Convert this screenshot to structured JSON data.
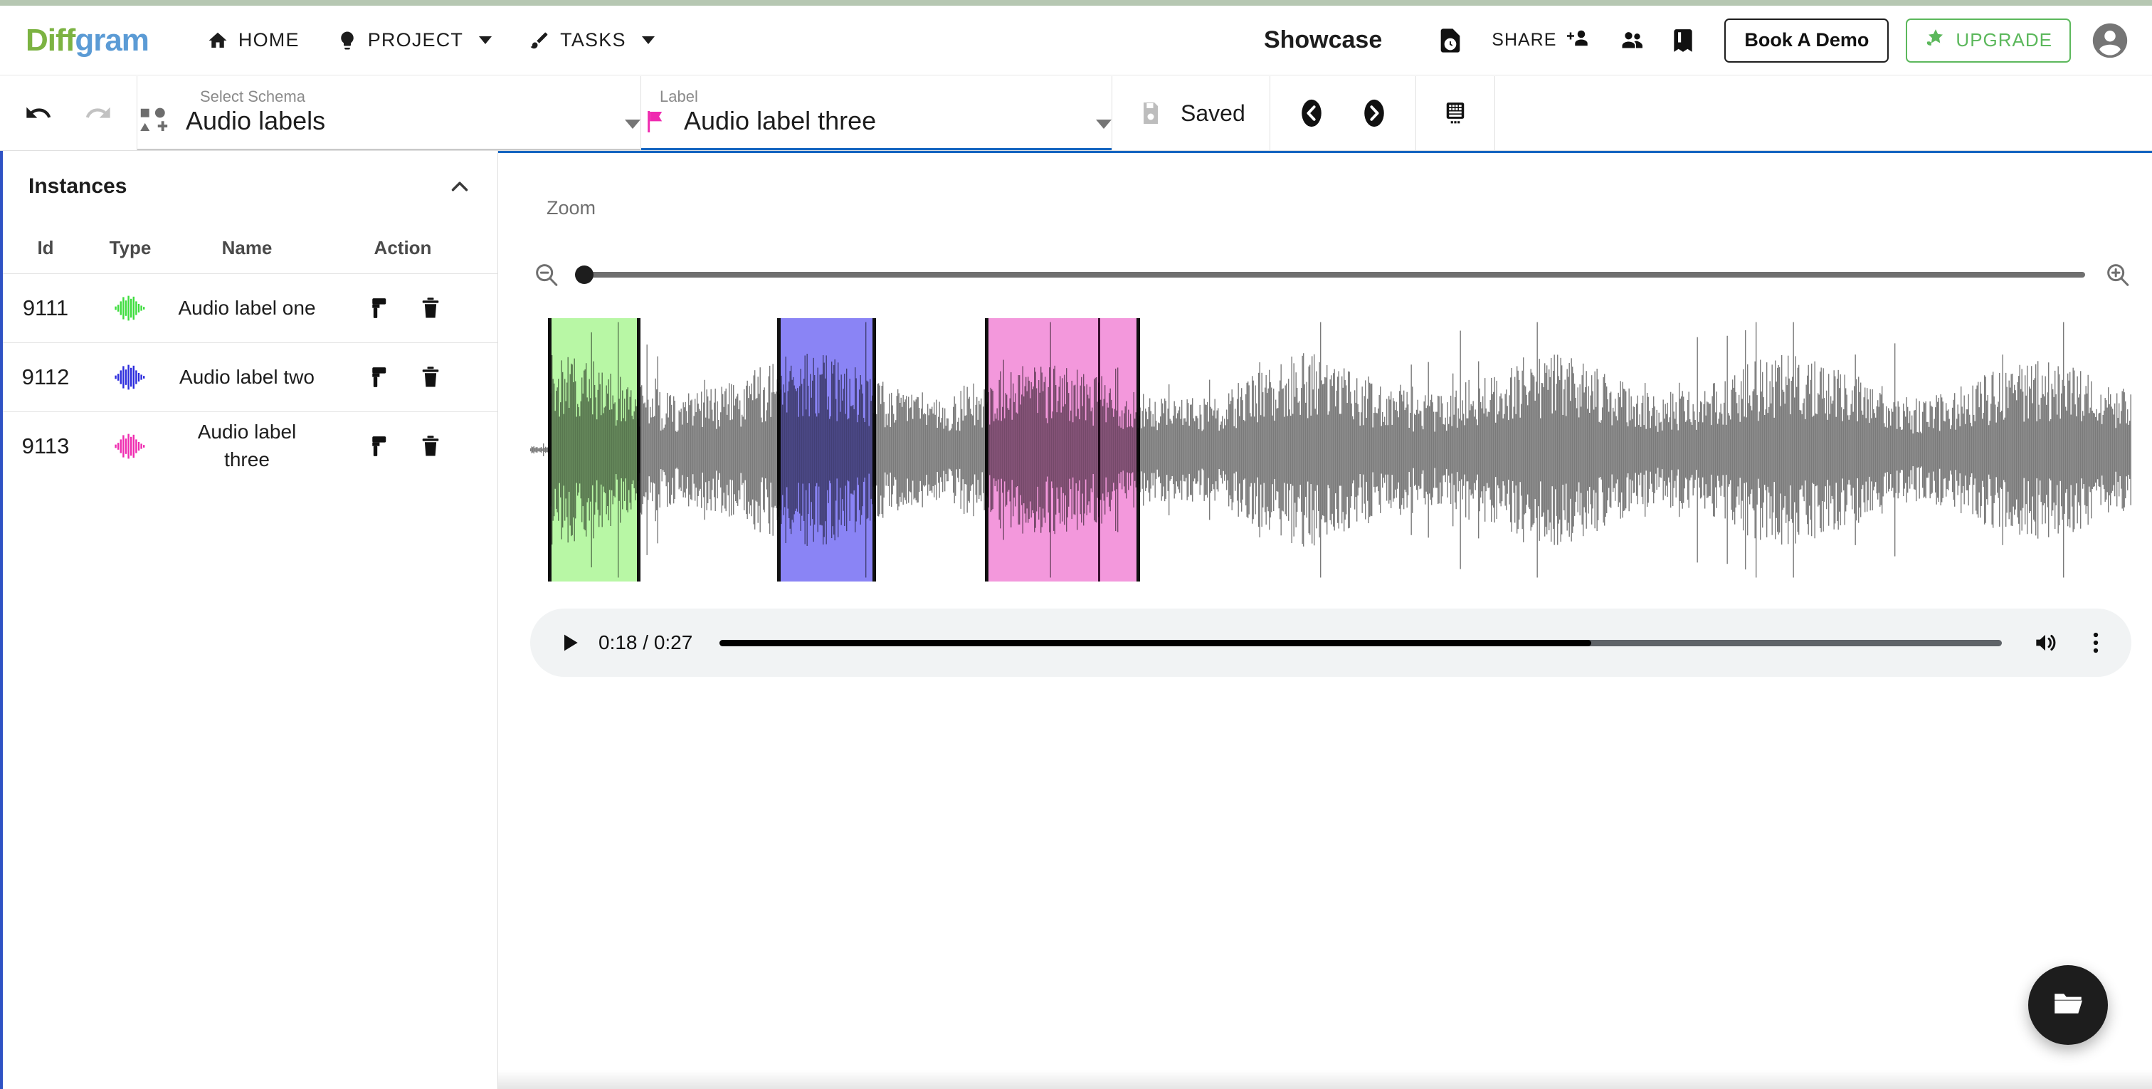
{
  "header": {
    "logo_part1": "Diff",
    "logo_part2": "gram",
    "nav": [
      {
        "label": "HOME",
        "icon": "home-icon",
        "has_caret": false
      },
      {
        "label": "PROJECT",
        "icon": "lightbulb-icon",
        "has_caret": true
      },
      {
        "label": "TASKS",
        "icon": "brush-icon",
        "has_caret": true
      }
    ],
    "project_title": "Showcase",
    "doc_time_icon": "document-clock-icon",
    "share_label": "SHARE",
    "share_icon": "person-add-icon",
    "members_icon": "people-icon",
    "guide_icon": "book-icon",
    "book_demo_label": "Book A Demo",
    "upgrade_label": "UPGRADE",
    "upgrade_icon": "star-rocket-icon",
    "upgrade_color": "#5cb85c",
    "avatar_icon": "account-circle-icon"
  },
  "toolbar": {
    "undo_icon": "undo-icon",
    "redo_icon": "redo-icon",
    "schema": {
      "label": "Select Schema",
      "value": "Audio labels",
      "icon": "schema-shapes-icon"
    },
    "label_select": {
      "label": "Label",
      "value": "Audio label three",
      "icon": "flag-icon",
      "flag_color": "#ef2bb0"
    },
    "save_status": "Saved",
    "save_icon": "save-icon",
    "prev_icon": "chevron-left-circle-icon",
    "next_icon": "chevron-right-circle-icon",
    "keyboard_icon": "keyboard-icon"
  },
  "sidebar": {
    "panel_title": "Instances",
    "collapse_icon": "chevron-up-icon",
    "columns": [
      "Id",
      "Type",
      "Name",
      "Action"
    ],
    "rows": [
      {
        "id": "9111",
        "type_icon": "audio-waveform-icon",
        "type_color": "#3ddd3d",
        "name": "Audio label one",
        "edit_icon": "brush-icon",
        "delete_icon": "trash-icon"
      },
      {
        "id": "9112",
        "type_icon": "audio-waveform-icon",
        "type_color": "#2b2bdd",
        "name": "Audio label two",
        "edit_icon": "brush-icon",
        "delete_icon": "trash-icon"
      },
      {
        "id": "9113",
        "type_icon": "audio-waveform-icon",
        "type_color": "#ef2bb0",
        "name": "Audio label three",
        "edit_icon": "brush-icon",
        "delete_icon": "trash-icon"
      }
    ]
  },
  "main": {
    "zoom_label": "Zoom",
    "zoom_out_icon": "magnify-minus-icon",
    "zoom_in_icon": "magnify-plus-icon",
    "zoom_value": 0,
    "regions": [
      {
        "name": "Audio label one",
        "color": "#b8f7a5",
        "left_pct": 1.1,
        "width_pct": 5.8
      },
      {
        "name": "Audio label two",
        "color": "#8a84f5",
        "left_pct": 15.4,
        "width_pct": 6.2
      },
      {
        "name": "Audio label three",
        "color": "#f398dc",
        "left_pct": 28.4,
        "width_pct": 9.7
      }
    ],
    "player": {
      "play_icon": "play-icon",
      "current_time": "0:18",
      "total_time": "0:27",
      "time_display": "0:18 / 0:27",
      "progress_pct": 68,
      "volume_icon": "volume-up-icon",
      "more_icon": "more-vertical-icon"
    },
    "fab_icon": "folder-open-icon"
  }
}
